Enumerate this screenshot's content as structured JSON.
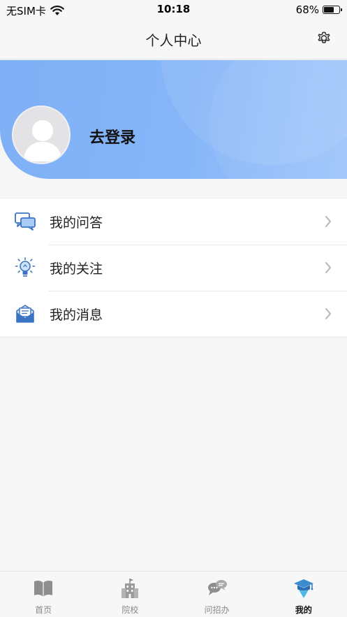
{
  "status_bar": {
    "carrier": "无SIM卡",
    "time": "10:18",
    "battery": "68%",
    "battery_level": 0.68
  },
  "nav": {
    "title": "个人中心",
    "settings_icon": "gear-icon"
  },
  "profile": {
    "login_label": "去登录",
    "avatar_icon": "default-avatar"
  },
  "menu": {
    "items": [
      {
        "label": "我的问答",
        "icon": "chat-bubbles-icon"
      },
      {
        "label": "我的关注",
        "icon": "lightbulb-icon"
      },
      {
        "label": "我的消息",
        "icon": "envelope-icon"
      }
    ]
  },
  "tabs": [
    {
      "label": "首页",
      "icon": "book-icon",
      "active": false
    },
    {
      "label": "院校",
      "icon": "building-icon",
      "active": false
    },
    {
      "label": "问招办",
      "icon": "chat-icon",
      "active": false
    },
    {
      "label": "我的",
      "icon": "graduation-cap-icon",
      "active": true
    }
  ],
  "colors": {
    "banner": "#86b6f8",
    "accent": "#4a90e2",
    "inactive_tab": "#888888"
  }
}
